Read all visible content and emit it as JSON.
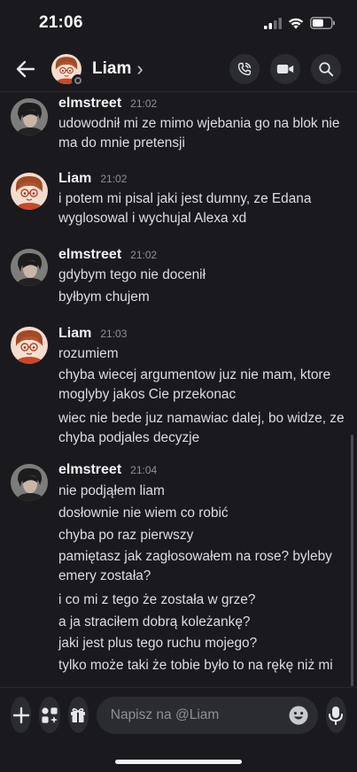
{
  "status_bar": {
    "time": "21:06"
  },
  "header": {
    "name": "Liam",
    "chevron": "›"
  },
  "composer": {
    "placeholder": "Napisz na @Liam"
  },
  "messages": [
    {
      "author": "elmstreet",
      "time": "21:02",
      "lines": [
        "udowodnił mi ze mimo wjebania go na blok nie",
        "ma do mnie pretensji"
      ]
    },
    {
      "author": "Liam",
      "time": "21:02",
      "lines": [
        "i potem mi pisal jaki jest dumny, ze Edana",
        "wyglosowal i wychujal Alexa xd"
      ]
    },
    {
      "author": "elmstreet",
      "time": "21:02",
      "lines": [
        "gdybym tego nie docenił",
        "byłbym chujem"
      ]
    },
    {
      "author": "Liam",
      "time": "21:03",
      "lines": [
        "rozumiem",
        "chyba wiecej argumentow juz nie mam, ktore",
        "moglyby jakos Cie przekonac",
        "wiec nie bede juz namawiac dalej, bo widze, ze",
        "chyba podjales decyzje"
      ]
    },
    {
      "author": "elmstreet",
      "time": "21:04",
      "lines": [
        "nie podjąłem liam",
        "dosłownie nie wiem co robić",
        "chyba po raz pierwszy",
        "pamiętasz jak zagłosowałem na rose? byleby",
        "emery została?",
        "i co mi z tego że została w grze?",
        "a ja straciłem dobrą koleżankę?",
        "jaki jest plus tego ruchu mojego?",
        "tylko może taki że tobie było to na rękę niż mi"
      ]
    }
  ],
  "icons": {
    "back": "arrow-left-icon",
    "call": "phone-call-icon",
    "video": "video-camera-icon",
    "search": "search-icon",
    "add": "plus-icon",
    "apps": "apps-icon",
    "gift": "gift-icon",
    "emoji": "emoji-icon",
    "mic": "microphone-icon"
  },
  "colors": {
    "background": "#1a1a1e",
    "button": "#2b2c32",
    "text": "#dcdde1"
  }
}
